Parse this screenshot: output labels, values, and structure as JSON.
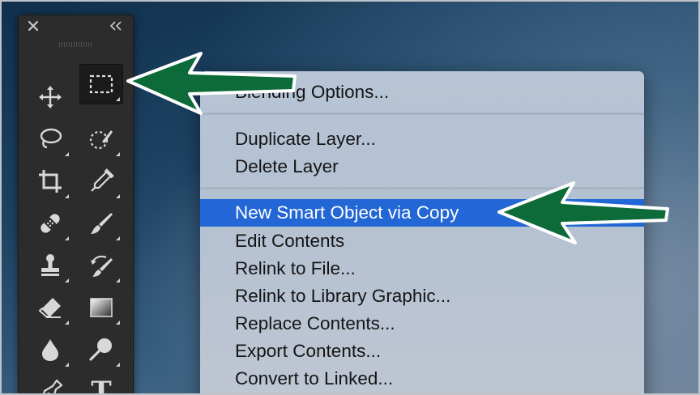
{
  "toolbar": {
    "close_icon": "close-icon",
    "collapse_icon": "double-chevron-left-icon",
    "tools": [
      {
        "name": "move-tool",
        "icon": "move-icon"
      },
      {
        "name": "rectangular-marquee-tool",
        "icon": "marquee-icon",
        "active": true
      },
      {
        "name": "lasso-tool",
        "icon": "lasso-icon"
      },
      {
        "name": "quick-selection-tool",
        "icon": "quick-selection-icon"
      },
      {
        "name": "crop-tool",
        "icon": "crop-icon"
      },
      {
        "name": "eyedropper-tool",
        "icon": "eyedropper-icon"
      },
      {
        "name": "healing-brush-tool",
        "icon": "bandage-icon"
      },
      {
        "name": "brush-tool",
        "icon": "brush-icon"
      },
      {
        "name": "clone-stamp-tool",
        "icon": "stamp-icon"
      },
      {
        "name": "history-brush-tool",
        "icon": "history-brush-icon"
      },
      {
        "name": "eraser-tool",
        "icon": "eraser-icon"
      },
      {
        "name": "gradient-tool",
        "icon": "gradient-icon"
      },
      {
        "name": "blur-tool",
        "icon": "drop-icon"
      },
      {
        "name": "dodge-tool",
        "icon": "dodge-icon"
      },
      {
        "name": "pen-tool",
        "icon": "pen-icon"
      },
      {
        "name": "type-tool",
        "icon": "type-icon",
        "label": "T"
      }
    ]
  },
  "context_menu": {
    "items": [
      {
        "label": "Blending Options...",
        "selected": false
      },
      {
        "label": "Duplicate Layer...",
        "selected": false
      },
      {
        "label": "Delete Layer",
        "selected": false
      },
      {
        "label": "New Smart Object via Copy",
        "selected": true
      },
      {
        "label": "Edit Contents",
        "selected": false
      },
      {
        "label": "Relink to File...",
        "selected": false
      },
      {
        "label": "Relink to Library Graphic...",
        "selected": false
      },
      {
        "label": "Replace Contents...",
        "selected": false
      },
      {
        "label": "Export Contents...",
        "selected": false
      },
      {
        "label": "Convert to Linked...",
        "selected": false
      }
    ]
  },
  "annotations": {
    "arrow_color": "#0c6b38",
    "arrow_outline": "#ffffff"
  },
  "colors": {
    "selection_highlight": "#2267d5",
    "toolbar_bg": "#2c2c2c"
  }
}
